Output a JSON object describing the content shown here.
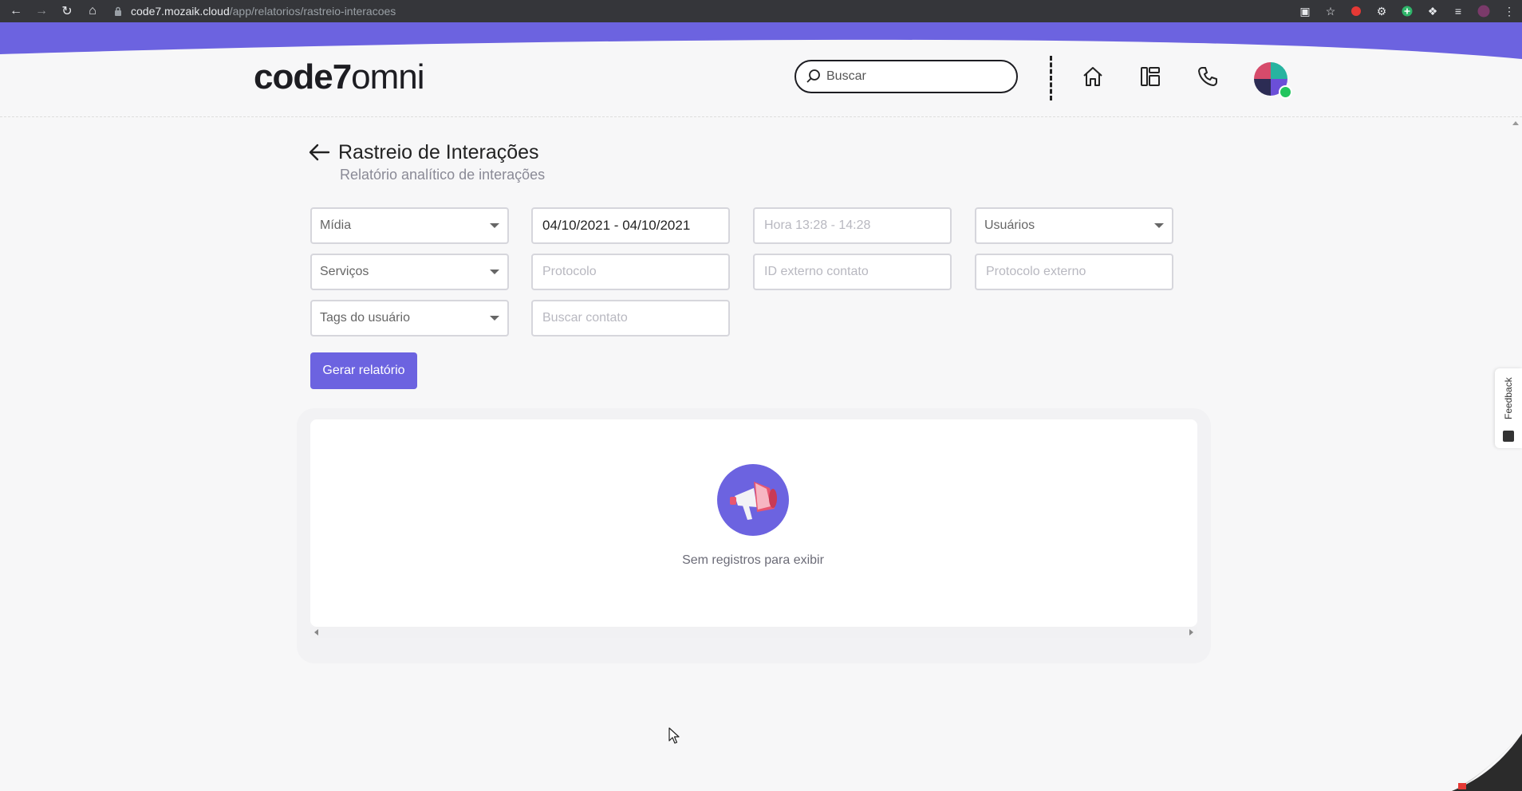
{
  "browser": {
    "url_host": "code7.mozaik.cloud",
    "url_path": "/app/relatorios/rastreio-interacoes"
  },
  "header": {
    "logo_bold": "code7",
    "logo_light": "omni",
    "search_placeholder": "Buscar"
  },
  "page": {
    "title": "Rastreio de Interações",
    "subtitle": "Relatório analítico de interações"
  },
  "filters": {
    "midia": "Mídia",
    "date_range": "04/10/2021 - 04/10/2021",
    "hora_placeholder": "Hora 13:28 - 14:28",
    "usuarios": "Usuários",
    "servicos": "Serviços",
    "protocolo_placeholder": "Protocolo",
    "id_externo_placeholder": "ID externo contato",
    "protocolo_externo_placeholder": "Protocolo externo",
    "tags": "Tags do usuário",
    "buscar_contato_placeholder": "Buscar contato",
    "generate_label": "Gerar relatório"
  },
  "results": {
    "empty_message": "Sem registros para exibir"
  },
  "feedback": {
    "label": "Feedback"
  },
  "colors": {
    "accent": "#6c63e0",
    "online": "#22c55e"
  }
}
